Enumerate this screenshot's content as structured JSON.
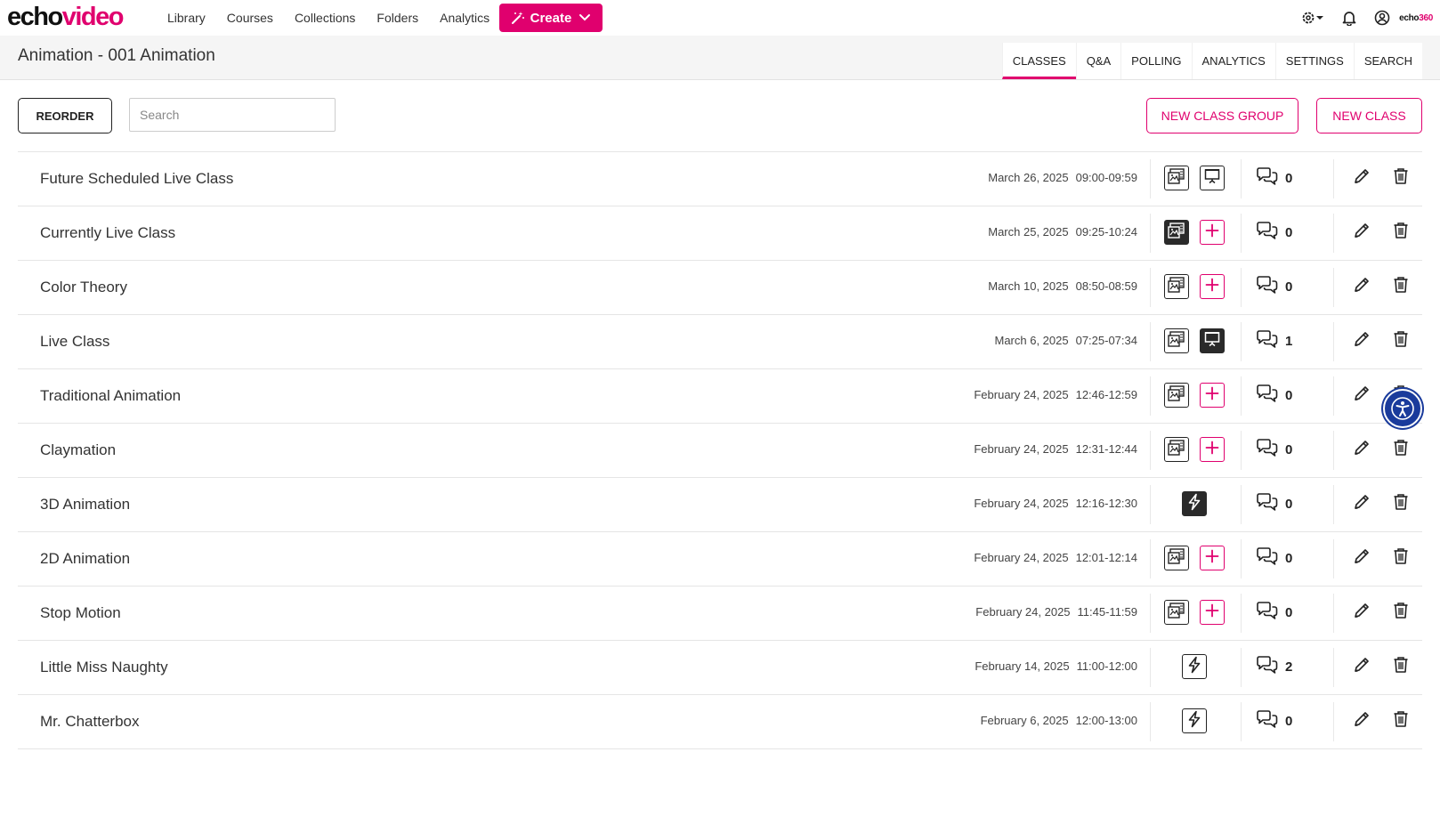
{
  "logo": {
    "part1": "echo",
    "part2": "video"
  },
  "nav": {
    "items": [
      {
        "label": "Library"
      },
      {
        "label": "Courses"
      },
      {
        "label": "Collections"
      },
      {
        "label": "Folders"
      },
      {
        "label": "Analytics"
      }
    ],
    "create_label": "Create"
  },
  "topright": {
    "brand_part1": "echo",
    "brand_part2": "360"
  },
  "course": {
    "title": "Animation - 001 Animation"
  },
  "tabs": [
    {
      "label": "CLASSES",
      "active": true
    },
    {
      "label": "Q&A"
    },
    {
      "label": "POLLING"
    },
    {
      "label": "ANALYTICS"
    },
    {
      "label": "SETTINGS"
    },
    {
      "label": "SEARCH"
    }
  ],
  "toolbar": {
    "reorder_label": "REORDER",
    "search_placeholder": "Search",
    "new_class_group_label": "NEW CLASS GROUP",
    "new_class_label": "NEW CLASS"
  },
  "classes": [
    {
      "name": "Future Scheduled Live Class",
      "date": "March 26, 2025",
      "time": "09:00-09:59",
      "media": "slides-outline",
      "second": "presentation-outline",
      "qa": "0"
    },
    {
      "name": "Currently Live Class",
      "date": "March 25, 2025",
      "time": "09:25-10:24",
      "media": "slides-filled",
      "second": "add",
      "qa": "0"
    },
    {
      "name": "Color Theory",
      "date": "March 10, 2025",
      "time": "08:50-08:59",
      "media": "slides-outline",
      "second": "add",
      "qa": "0"
    },
    {
      "name": "Live Class",
      "date": "March 6, 2025",
      "time": "07:25-07:34",
      "media": "slides-outline",
      "second": "presentation-filled",
      "qa": "1"
    },
    {
      "name": "Traditional Animation",
      "date": "February 24, 2025",
      "time": "12:46-12:59",
      "media": "slides-outline",
      "second": "add",
      "qa": "0"
    },
    {
      "name": "Claymation",
      "date": "February 24, 2025",
      "time": "12:31-12:44",
      "media": "slides-outline",
      "second": "add",
      "qa": "0"
    },
    {
      "name": "3D Animation",
      "date": "February 24, 2025",
      "time": "12:16-12:30",
      "media": "lightning-filled",
      "second": "",
      "qa": "0"
    },
    {
      "name": "2D Animation",
      "date": "February 24, 2025",
      "time": "12:01-12:14",
      "media": "slides-outline",
      "second": "add",
      "qa": "0"
    },
    {
      "name": "Stop Motion",
      "date": "February 24, 2025",
      "time": "11:45-11:59",
      "media": "slides-outline",
      "second": "add",
      "qa": "0"
    },
    {
      "name": "Little Miss Naughty",
      "date": "February 14, 2025",
      "time": "11:00-12:00",
      "media": "lightning-outline",
      "second": "",
      "qa": "2"
    },
    {
      "name": "Mr. Chatterbox",
      "date": "February 6, 2025",
      "time": "12:00-13:00",
      "media": "lightning-outline",
      "second": "",
      "qa": "0"
    }
  ],
  "icons": {
    "settings": "gear-icon",
    "notifications": "bell-icon",
    "account": "user-circle-icon",
    "qa": "chat-bubbles-icon",
    "edit": "pencil-icon",
    "delete": "trash-icon",
    "accessibility": "accessibility-icon"
  },
  "colors": {
    "accent": "#e0006e",
    "dark": "#222222",
    "accessibility": "#1a3b9c"
  }
}
